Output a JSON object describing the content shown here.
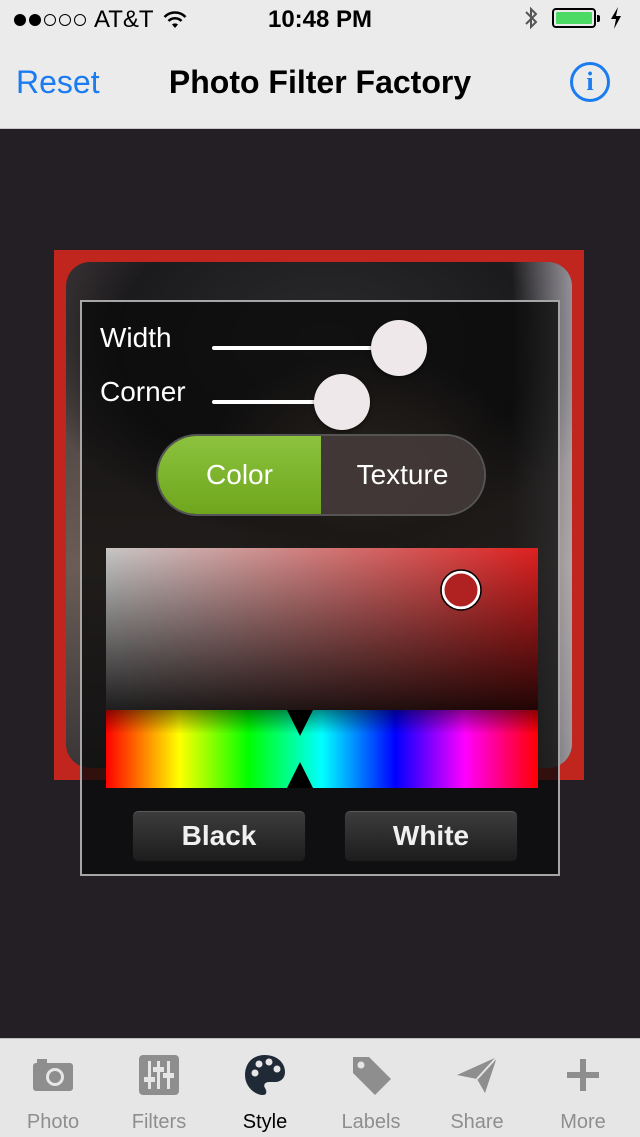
{
  "status_bar": {
    "carrier": "AT&T",
    "time": "10:48 PM",
    "battery_fill_fraction": 1.0
  },
  "nav": {
    "reset_label": "Reset",
    "title": "Photo Filter Factory",
    "info_glyph": "i"
  },
  "style_panel": {
    "width_label": "Width",
    "width_value_fraction": 0.89,
    "corner_label": "Corner",
    "corner_value_fraction": 0.62,
    "segments": [
      {
        "label": "Color",
        "selected": true
      },
      {
        "label": "Texture",
        "selected": false
      }
    ],
    "selected_hue_fraction": 0.45,
    "black_label": "Black",
    "white_label": "White"
  },
  "colors": {
    "accent": "#1a7cf0",
    "frame": "#c0261d",
    "segment_selected": "#7ab22a"
  },
  "tabbar": {
    "items": [
      {
        "label": "Photo",
        "icon": "camera-icon"
      },
      {
        "label": "Filters",
        "icon": "sliders-icon"
      },
      {
        "label": "Style",
        "icon": "palette-icon"
      },
      {
        "label": "Labels",
        "icon": "tag-icon"
      },
      {
        "label": "Share",
        "icon": "send-icon"
      },
      {
        "label": "More",
        "icon": "plus-icon"
      }
    ],
    "active_index": 2
  }
}
